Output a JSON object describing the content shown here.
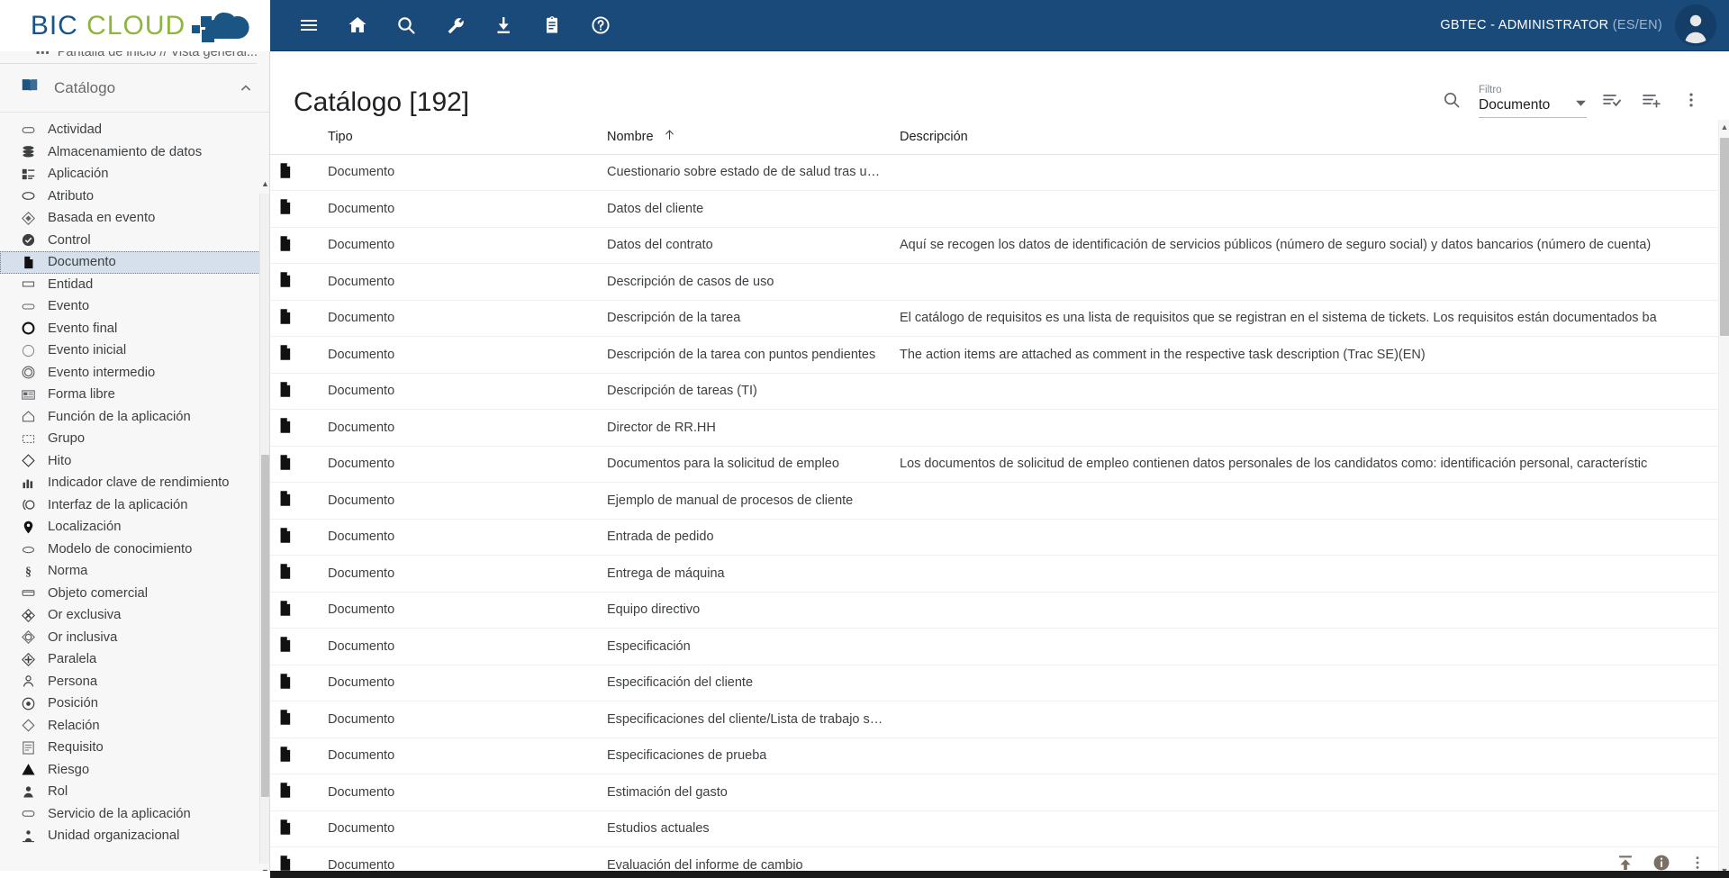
{
  "header": {
    "logo": {
      "part1": "BIC",
      "part2": "CLOUD"
    },
    "nav_icons": [
      {
        "name": "menu-icon",
        "label": "Menú"
      },
      {
        "name": "home-icon",
        "label": "Inicio"
      },
      {
        "name": "search-icon",
        "label": "Buscar"
      },
      {
        "name": "wrench-icon",
        "label": "Herramientas"
      },
      {
        "name": "download-icon",
        "label": "Descargar"
      },
      {
        "name": "clipboard-icon",
        "label": "Portapapeles"
      },
      {
        "name": "help-icon",
        "label": "Ayuda"
      }
    ],
    "user": "GBTEC - ADMINISTRATOR",
    "user_locale": "(ES/EN)"
  },
  "sidebar": {
    "breadcrumb_icon": "grid-icon",
    "breadcrumb": "Pantalla de inicio // Vista general...",
    "section_title": "Catálogo",
    "section_icon": "book-icon",
    "collapse_icon": "chevron-up-icon",
    "items": [
      {
        "label": "Actividad",
        "icon": "rounded-rect-icon"
      },
      {
        "label": "Almacenamiento de datos",
        "icon": "database-icon"
      },
      {
        "label": "Aplicación",
        "icon": "application-icon"
      },
      {
        "label": "Atributo",
        "icon": "ellipse-icon"
      },
      {
        "label": "Basada en evento",
        "icon": "event-based-gateway-icon"
      },
      {
        "label": "Control",
        "icon": "check-circle-filled-icon"
      },
      {
        "label": "Documento",
        "icon": "document-icon",
        "selected": true
      },
      {
        "label": "Entidad",
        "icon": "rect-icon"
      },
      {
        "label": "Evento",
        "icon": "rounded-rect-outline-icon"
      },
      {
        "label": "Evento final",
        "icon": "circle-thick-icon"
      },
      {
        "label": "Evento inicial",
        "icon": "circle-thin-icon"
      },
      {
        "label": "Evento intermedio",
        "icon": "circle-double-icon"
      },
      {
        "label": "Forma libre",
        "icon": "free-form-icon"
      },
      {
        "label": "Función de la aplicación",
        "icon": "app-function-icon"
      },
      {
        "label": "Grupo",
        "icon": "dashed-rect-icon"
      },
      {
        "label": "Hito",
        "icon": "diamond-icon"
      },
      {
        "label": "Indicador clave de rendimiento",
        "icon": "bar-chart-icon"
      },
      {
        "label": "Interfaz de la aplicación",
        "icon": "app-interface-icon"
      },
      {
        "label": "Localización",
        "icon": "map-pin-icon"
      },
      {
        "label": "Modelo de conocimiento",
        "icon": "knowledge-model-icon"
      },
      {
        "label": "Norma",
        "icon": "section-sign-icon"
      },
      {
        "label": "Objeto comercial",
        "icon": "business-object-icon"
      },
      {
        "label": "Or exclusiva",
        "icon": "xor-gateway-icon"
      },
      {
        "label": "Or inclusiva",
        "icon": "or-gateway-icon"
      },
      {
        "label": "Paralela",
        "icon": "parallel-gateway-icon"
      },
      {
        "label": "Persona",
        "icon": "person-icon"
      },
      {
        "label": "Posición",
        "icon": "position-icon"
      },
      {
        "label": "Relación",
        "icon": "diamond-outline-icon"
      },
      {
        "label": "Requisito",
        "icon": "requirement-icon"
      },
      {
        "label": "Riesgo",
        "icon": "warning-triangle-icon"
      },
      {
        "label": "Rol",
        "icon": "role-icon"
      },
      {
        "label": "Servicio de la aplicación",
        "icon": "app-service-icon"
      },
      {
        "label": "Unidad organizacional",
        "icon": "org-unit-icon"
      }
    ]
  },
  "main": {
    "title": "Catálogo [192]",
    "toolbar": {
      "search_icon": "search-icon",
      "filter_label": "Filtro",
      "filter_value": "Documento",
      "dropdown_icon": "chevron-down-icon",
      "select_list_icon": "list-check-icon",
      "add_list_icon": "list-plus-icon",
      "more_icon": "more-vertical-icon"
    },
    "table": {
      "columns": [
        "Tipo",
        "Nombre",
        "Descripción"
      ],
      "sort_column": "Nombre",
      "sort_icon": "arrow-up-icon",
      "rows": [
        {
          "tipo": "Documento",
          "nombre": "Cuestionario sobre estado de de salud tras un…",
          "descripcion": ""
        },
        {
          "tipo": "Documento",
          "nombre": "Datos del cliente",
          "descripcion": ""
        },
        {
          "tipo": "Documento",
          "nombre": "Datos del contrato",
          "descripcion": "Aquí se recogen los datos de identificación de servicios públicos (número de seguro social) y datos bancarios (número de cuenta)"
        },
        {
          "tipo": "Documento",
          "nombre": "Descripción de casos de uso",
          "descripcion": ""
        },
        {
          "tipo": "Documento",
          "nombre": "Descripción de la tarea",
          "descripcion": "El catálogo de requisitos es una lista de requisitos que se registran en el sistema de tickets. Los requisitos están documentados ba"
        },
        {
          "tipo": "Documento",
          "nombre": "Descripción de la tarea con puntos pendientes",
          "descripcion": "The action items are attached as comment in the respective task description (Trac SE)(EN)"
        },
        {
          "tipo": "Documento",
          "nombre": "Descripción de tareas (TI)",
          "descripcion": ""
        },
        {
          "tipo": "Documento",
          "nombre": "Director de RR.HH",
          "descripcion": ""
        },
        {
          "tipo": "Documento",
          "nombre": "Documentos para la solicitud de empleo",
          "descripcion": "Los documentos de solicitud de empleo contienen datos personales de los candidatos como: identificación personal, característic"
        },
        {
          "tipo": "Documento",
          "nombre": "Ejemplo de manual de procesos de cliente",
          "descripcion": ""
        },
        {
          "tipo": "Documento",
          "nombre": "Entrada de pedido",
          "descripcion": ""
        },
        {
          "tipo": "Documento",
          "nombre": "Entrega de máquina",
          "descripcion": ""
        },
        {
          "tipo": "Documento",
          "nombre": "Equipo directivo",
          "descripcion": ""
        },
        {
          "tipo": "Documento",
          "nombre": "Especificación",
          "descripcion": ""
        },
        {
          "tipo": "Documento",
          "nombre": "Especificación del cliente",
          "descripcion": ""
        },
        {
          "tipo": "Documento",
          "nombre": "Especificaciones del cliente/Lista de trabajo s…",
          "descripcion": ""
        },
        {
          "tipo": "Documento",
          "nombre": "Especificaciones de prueba",
          "descripcion": ""
        },
        {
          "tipo": "Documento",
          "nombre": "Estimación del gasto",
          "descripcion": ""
        },
        {
          "tipo": "Documento",
          "nombre": "Estudios actuales",
          "descripcion": ""
        },
        {
          "tipo": "Documento",
          "nombre": "Evaluación del informe de cambio",
          "descripcion": ""
        }
      ],
      "row_icon": "document-icon"
    },
    "footer_icons": [
      {
        "name": "upload-icon"
      },
      {
        "name": "info-icon"
      },
      {
        "name": "more-vertical-icon"
      }
    ]
  },
  "colors": {
    "topbar": "#1a4a7a",
    "accent_blue": "#18538a",
    "accent_green": "#8cb63c",
    "selection": "#d6e0ed"
  }
}
